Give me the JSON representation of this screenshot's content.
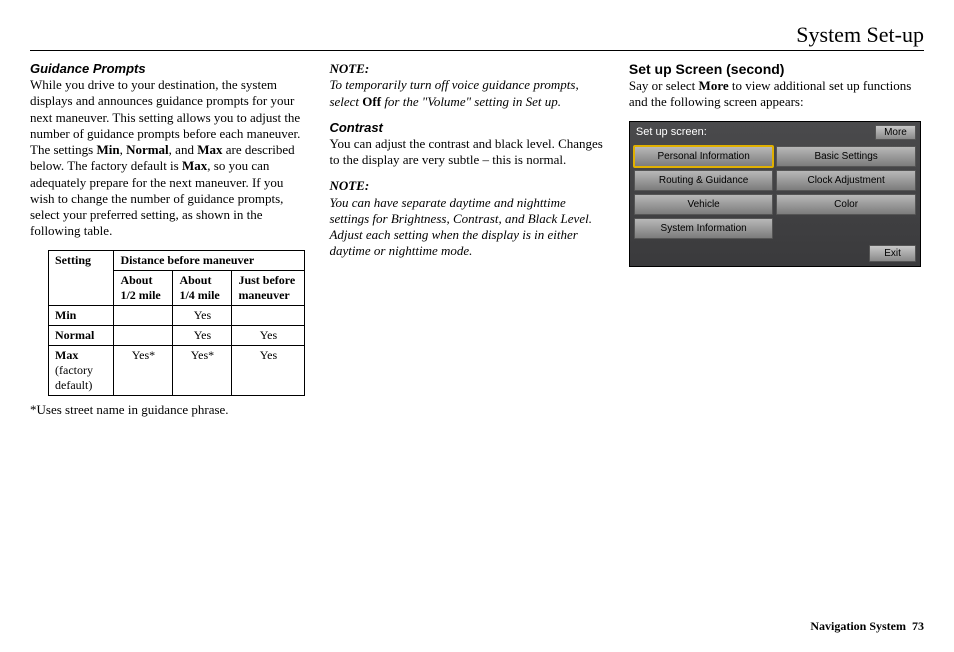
{
  "header": {
    "title": "System Set-up"
  },
  "col1": {
    "heading": "Guidance Prompts",
    "para_pre": "While you drive to your destination, the system displays and announces guidance prompts for your next maneuver. This setting allows you to adjust the number of guidance prompts before each maneuver. The settings ",
    "b1": "Min",
    "sep1": ", ",
    "b2": "Normal",
    "sep2": ", and ",
    "b3": "Max",
    "mid": " are described below. The factory default is ",
    "b4": "Max",
    "para_post": ", so you can adequately prepare for the next maneuver. If you wish to change the number of guidance prompts, select your preferred setting, as shown in the following table.",
    "table": {
      "h1": "Setting",
      "h2": "Distance before maneuver",
      "sub1": "About 1/2 mile",
      "sub2": "About 1/4 mile",
      "sub3": "Just before maneuver",
      "rows": [
        {
          "label": "Min",
          "sublabel": "",
          "c1": "",
          "c2": "Yes",
          "c3": ""
        },
        {
          "label": "Normal",
          "sublabel": "",
          "c1": "",
          "c2": "Yes",
          "c3": "Yes"
        },
        {
          "label": "Max",
          "sublabel": "(factory default)",
          "c1": "Yes*",
          "c2": "Yes*",
          "c3": "Yes"
        }
      ]
    },
    "footnote": "*Uses street name in guidance phrase."
  },
  "col2": {
    "note1_label": "NOTE:",
    "note1_pre": "To temporarily turn off voice guidance prompts, select ",
    "note1_b": "Off",
    "note1_post": " for the \"Volume\" setting in Set up.",
    "heading2": "Contrast",
    "para2": "You can adjust the contrast and black level. Changes to the display are very subtle – this is normal.",
    "note2_label": "NOTE:",
    "note2_body": "You can have separate daytime and nighttime settings for Brightness, Contrast, and Black Level. Adjust each setting when the display is in either daytime or nighttime mode."
  },
  "col3": {
    "heading": "Set up Screen (second)",
    "para_pre": "Say or select ",
    "para_b": "More",
    "para_post": " to view additional set up functions and the following screen appears:",
    "screen": {
      "title": "Set up screen:",
      "more": "More",
      "buttons": [
        {
          "label": "Personal Information",
          "selected": true
        },
        {
          "label": "Basic Settings",
          "selected": false
        },
        {
          "label": "Routing & Guidance",
          "selected": false
        },
        {
          "label": "Clock Adjustment",
          "selected": false
        },
        {
          "label": "Vehicle",
          "selected": false
        },
        {
          "label": "Color",
          "selected": false
        },
        {
          "label": "System Information",
          "selected": false
        }
      ],
      "exit": "Exit"
    }
  },
  "footer": {
    "label": "Navigation System",
    "page": "73"
  }
}
